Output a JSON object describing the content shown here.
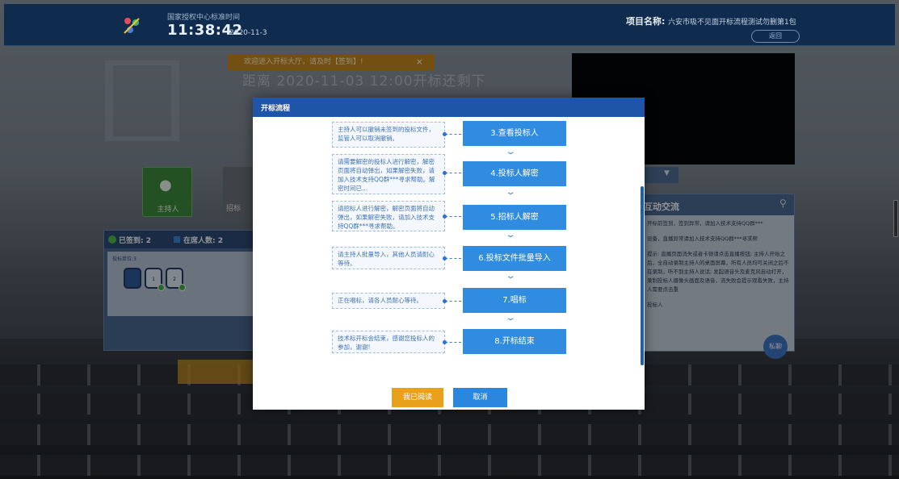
{
  "header": {
    "clock_label": "国家授权中心标准时间",
    "time": "11:38:42",
    "date": "2020-11-3",
    "project_label": "项目名称:",
    "project_value": "六安市吸不见面开标流程测试勿删第1包",
    "back_label": "返回"
  },
  "background": {
    "notice": "欢迎进入开标大厅，请及时【签到】!",
    "notice_close": "×",
    "countdown": "距离 2020-11-03 12:00开标还剩下",
    "roles": {
      "host": "主持人",
      "bidder": "招标"
    },
    "attendance": {
      "signed": "已签到: 2",
      "online": "在席人数: 2",
      "area_title": "投标单位:3",
      "seats": [
        "",
        "1",
        "2"
      ]
    },
    "chat": {
      "title": "互动交流",
      "lines": [
        "开标前签到，签到异常，请加入技术支持QQ群***",
        "设备，直播异常请加入技术支持QQ群***寻求帮",
        "提示: 直播页面消失或者卡顿请点击直播按钮; 主持人开始之后，全自动录制主持人的桌面屏幕，所有人员均可关闭之后不在录制，听不到主持人说话; 发起语音头及麦克风自动打开，录制投标人摄像头画面及语音，流失败会提示观看失败，主持人需要点击重",
        "投标人"
      ],
      "fab": "私聊"
    }
  },
  "modal": {
    "title": "开标流程",
    "steps": [
      {
        "label": "3.查看投标人",
        "tip": "主持人可以撤销未签到的投标文件，监管人可以取消撤销。"
      },
      {
        "label": "4.投标人解密",
        "tip": "请需要解密的投标人进行解密，解密页面将自动弹出，如果解密失败，请加入技术支持QQ群***寻求帮助。解密时间已..."
      },
      {
        "label": "5.招标人解密",
        "tip": "请招标人进行解密，解密页面将自动弹出，如果解密失败，请加入技术支持QQ群***寻求帮助。"
      },
      {
        "label": "6.投标文件批量导入",
        "tip": "请主持人批量导入，其他人员请耐心等待。"
      },
      {
        "label": "7.唱标",
        "tip": "正在唱标，请各人员耐心等待。"
      },
      {
        "label": "8.开标结束",
        "tip": "技术标开标会结束，感谢您投标人的参加，谢谢!"
      }
    ],
    "chevron": "⌄",
    "buttons": {
      "read": "我已阅读",
      "cancel": "取消"
    }
  },
  "colors": {
    "header_bg": "#0f2c4f",
    "modal_head": "#1e55a8",
    "step_blue": "#2f8ce0",
    "read_orange": "#e9a11c",
    "cancel_blue": "#2b86de",
    "notice_orange": "#c98a1c"
  }
}
